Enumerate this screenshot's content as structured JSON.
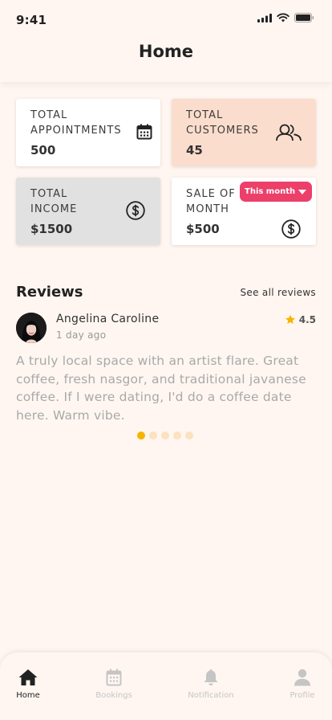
{
  "status": {
    "time": "9:41"
  },
  "header": {
    "title": "Home"
  },
  "stats": {
    "appointments": {
      "label_1": "TOTAL",
      "label_2": "APPOINTMENTS",
      "value": "500",
      "icon": "calendar-icon"
    },
    "customers": {
      "label_1": "TOTAL",
      "label_2": "CUSTOMERS",
      "value": "45",
      "icon": "users-icon"
    },
    "income": {
      "label_1": "TOTAL",
      "label_2": "INCOME",
      "value": "$1500",
      "icon": "dollar-icon"
    },
    "sale": {
      "label_1": "SALE OF",
      "label_2": "MONTH",
      "value": "$500",
      "icon": "dollar-icon",
      "filter": "This month"
    }
  },
  "reviews": {
    "title": "Reviews",
    "see_all": "See all reviews",
    "item": {
      "name": "Angelina Caroline",
      "date": "1 day ago",
      "rating": "4.5",
      "text": "A truly local space with an artist flare. Great coffee, fresh nasgor, and traditional javanese coffee. If I were dating, I'd do a coffee date here. Warm vibe."
    },
    "pager": {
      "count": 5,
      "active": 1
    }
  },
  "tabs": [
    {
      "label": "Home",
      "icon": "home-icon",
      "active": true
    },
    {
      "label": "Bookings",
      "icon": "calendar-icon",
      "active": false
    },
    {
      "label": "Notification",
      "icon": "bell-icon",
      "active": false
    },
    {
      "label": "Profile",
      "icon": "profile-icon",
      "active": false
    }
  ],
  "colors": {
    "background": "#FFF6F1",
    "accent": "#EC3F6A",
    "star": "#F6B400",
    "peach": "#FBDDCD",
    "gray_card": "#E1E1E1"
  }
}
